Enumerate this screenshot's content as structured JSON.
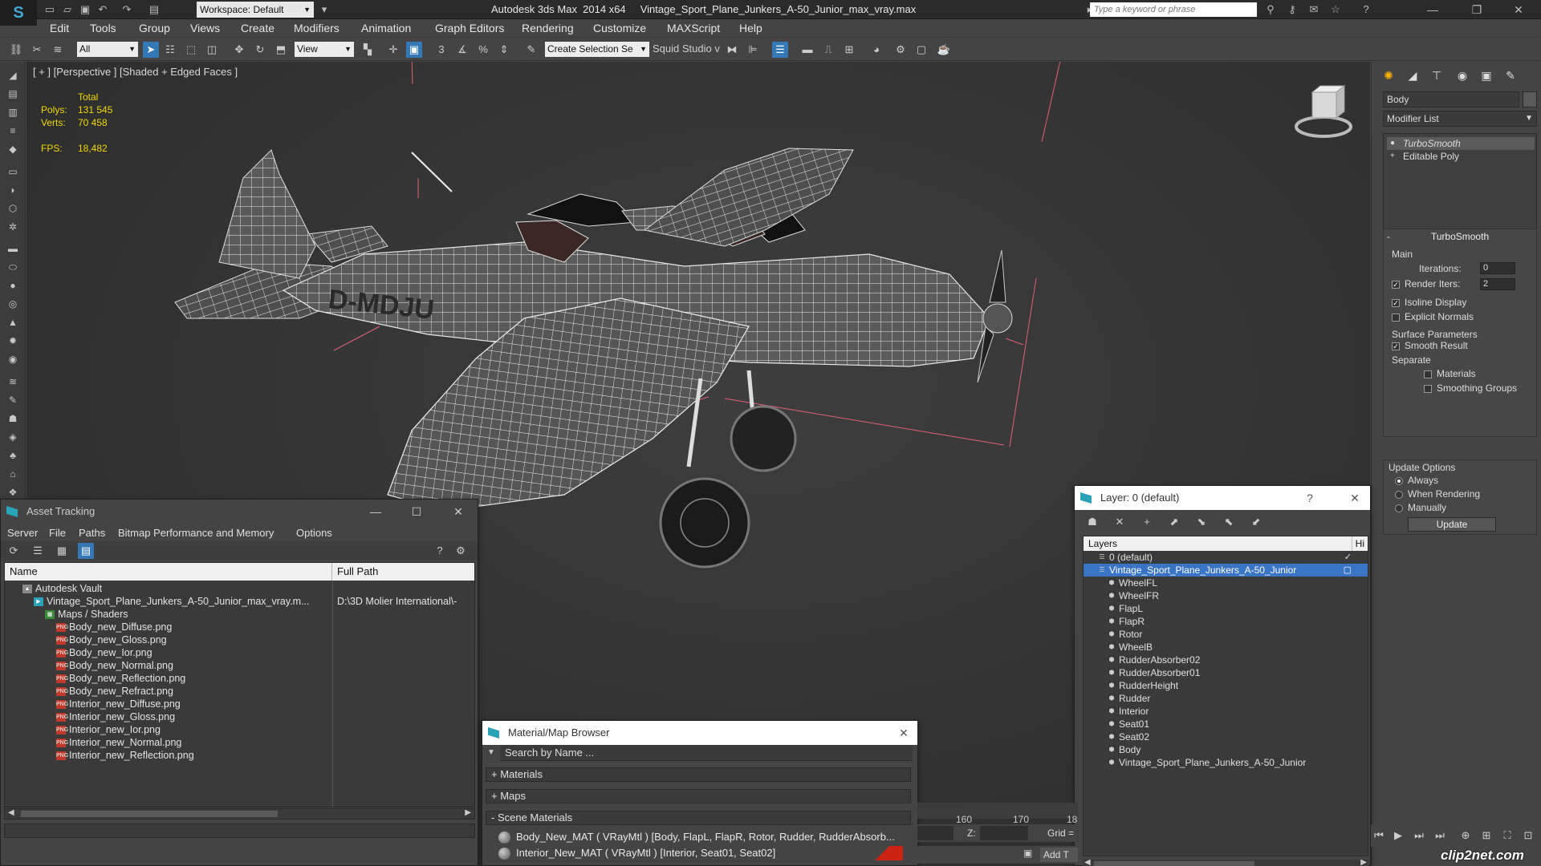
{
  "titlebar": {
    "workspace": "Workspace: Default",
    "title": "Autodesk 3ds Max  2014 x64     Vintage_Sport_Plane_Junkers_A-50_Junior_max_vray.max",
    "search_placeholder": "Type a keyword or phrase"
  },
  "menu": [
    "Edit",
    "Tools",
    "Group",
    "Views",
    "Create",
    "Modifiers",
    "Animation",
    "Graph Editors",
    "Rendering",
    "Customize",
    "MAXScript",
    "Help"
  ],
  "toolbar": {
    "filter": "All",
    "ref_coord": "View",
    "selection_set": "Create Selection Se",
    "squid": "Squid Studio v"
  },
  "viewport": {
    "label": "[ + ] [Perspective ] [Shaded + Edged Faces ]",
    "stats_header": "Total",
    "polys_label": "Polys:",
    "polys": "131 545",
    "verts_label": "Verts:",
    "verts": "70 458",
    "fps_label": "FPS:",
    "fps": "18,482",
    "registration": "D-MDJU"
  },
  "command_panel": {
    "object_name": "Body",
    "modifier_list": "Modifier List",
    "stack": [
      "TurboSmooth",
      "Editable Poly"
    ],
    "turbosmooth": {
      "title": "TurboSmooth",
      "main": "Main",
      "iterations_label": "Iterations:",
      "iterations": "0",
      "render_iters_label": "Render Iters:",
      "render_iters": "2",
      "isoline": "Isoline Display",
      "explicit": "Explicit Normals",
      "surface": "Surface Parameters",
      "smooth_result": "Smooth Result",
      "separate": "Separate",
      "materials": "Materials",
      "smoothing_groups": "Smoothing Groups",
      "update_options": "Update Options",
      "always": "Always",
      "when_rendering": "When Rendering",
      "manually": "Manually",
      "update": "Update"
    }
  },
  "asset_tracking": {
    "title": "Asset Tracking",
    "menu": [
      "Server",
      "File",
      "Paths",
      "Bitmap Performance and Memory",
      "Options"
    ],
    "col_name": "Name",
    "col_path": "Full Path",
    "rows": [
      {
        "name": "Autodesk Vault",
        "path": "",
        "indent": 1,
        "icon": "vault"
      },
      {
        "name": "Vintage_Sport_Plane_Junkers_A-50_Junior_max_vray.m...",
        "path": "D:\\3D Molier International\\-",
        "indent": 2,
        "icon": "max"
      },
      {
        "name": "Maps / Shaders",
        "path": "",
        "indent": 3,
        "icon": "maps"
      },
      {
        "name": "Body_new_Diffuse.png",
        "path": "",
        "indent": 4,
        "icon": "png"
      },
      {
        "name": "Body_new_Gloss.png",
        "path": "",
        "indent": 4,
        "icon": "png"
      },
      {
        "name": "Body_new_Ior.png",
        "path": "",
        "indent": 4,
        "icon": "png"
      },
      {
        "name": "Body_new_Normal.png",
        "path": "",
        "indent": 4,
        "icon": "png"
      },
      {
        "name": "Body_new_Reflection.png",
        "path": "",
        "indent": 4,
        "icon": "png"
      },
      {
        "name": "Body_new_Refract.png",
        "path": "",
        "indent": 4,
        "icon": "png"
      },
      {
        "name": "Interior_new_Diffuse.png",
        "path": "",
        "indent": 4,
        "icon": "png"
      },
      {
        "name": "Interior_new_Gloss.png",
        "path": "",
        "indent": 4,
        "icon": "png"
      },
      {
        "name": "Interior_new_Ior.png",
        "path": "",
        "indent": 4,
        "icon": "png"
      },
      {
        "name": "Interior_new_Normal.png",
        "path": "",
        "indent": 4,
        "icon": "png"
      },
      {
        "name": "Interior_new_Reflection.png",
        "path": "",
        "indent": 4,
        "icon": "png"
      }
    ]
  },
  "material_browser": {
    "title": "Material/Map Browser",
    "search": "Search by Name ...",
    "sections": [
      "+ Materials",
      "+ Maps",
      "- Scene Materials"
    ],
    "items": [
      "Body_New_MAT ( VRayMtl ) [Body, FlapL, FlapR, Rotor, Rudder, RudderAbsorb...",
      "Interior_New_MAT ( VRayMtl ) [Interior, Seat01, Seat02]"
    ]
  },
  "layers": {
    "title": "Layer: 0 (default)",
    "col_layers": "Layers",
    "col_hide": "Hi",
    "rows": [
      {
        "name": "0 (default)",
        "indent": 1,
        "sel": false
      },
      {
        "name": "Vintage_Sport_Plane_Junkers_A-50_Junior",
        "indent": 1,
        "sel": true
      },
      {
        "name": "WheelFL",
        "indent": 2,
        "sel": false
      },
      {
        "name": "WheelFR",
        "indent": 2,
        "sel": false
      },
      {
        "name": "FlapL",
        "indent": 2,
        "sel": false
      },
      {
        "name": "FlapR",
        "indent": 2,
        "sel": false
      },
      {
        "name": "Rotor",
        "indent": 2,
        "sel": false
      },
      {
        "name": "WheelB",
        "indent": 2,
        "sel": false
      },
      {
        "name": "RudderAbsorber02",
        "indent": 2,
        "sel": false
      },
      {
        "name": "RudderAbsorber01",
        "indent": 2,
        "sel": false
      },
      {
        "name": "RudderHeight",
        "indent": 2,
        "sel": false
      },
      {
        "name": "Rudder",
        "indent": 2,
        "sel": false
      },
      {
        "name": "Interior",
        "indent": 2,
        "sel": false
      },
      {
        "name": "Seat01",
        "indent": 2,
        "sel": false
      },
      {
        "name": "Seat02",
        "indent": 2,
        "sel": false
      },
      {
        "name": "Body",
        "indent": 2,
        "sel": false
      },
      {
        "name": "Vintage_Sport_Plane_Junkers_A-50_Junior",
        "indent": 2,
        "sel": false
      }
    ]
  },
  "bottom": {
    "tick160": "160",
    "tick170": "170",
    "tick_partial": "18",
    "z_label": "Z:",
    "grid": "Grid =",
    "add": "Add T",
    "watermark": "clip2net.com"
  },
  "colors": {
    "accent": "#3478b6",
    "stats": "#f2d700",
    "selection": "#3a74c4"
  }
}
